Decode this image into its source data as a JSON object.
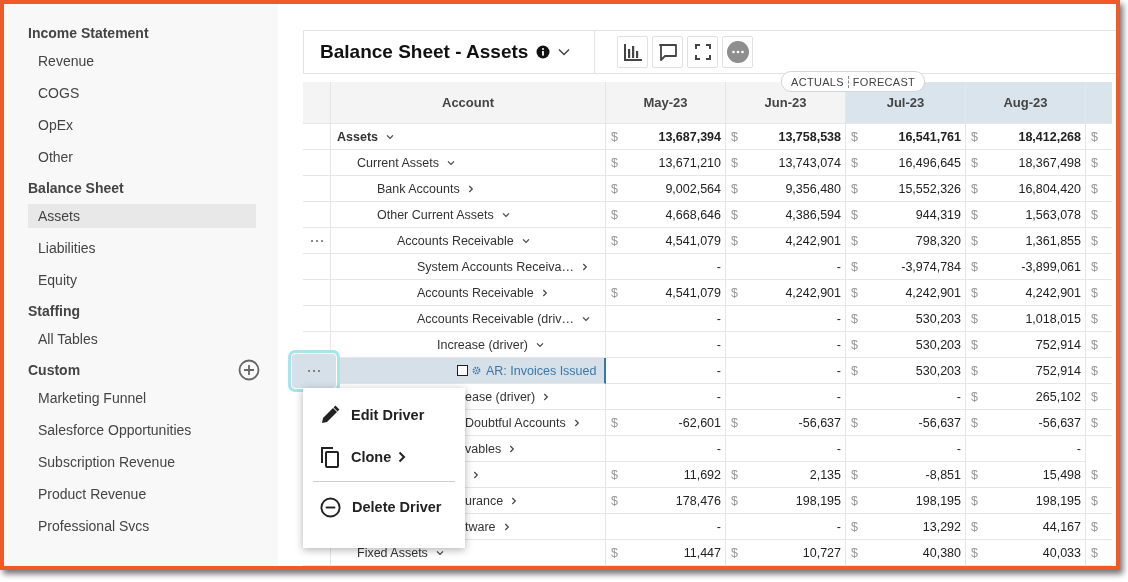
{
  "sidebar": {
    "sections": [
      {
        "title": "Income Statement",
        "items": [
          {
            "label": "Revenue",
            "selected": false
          },
          {
            "label": "COGS",
            "selected": false
          },
          {
            "label": "OpEx",
            "selected": false
          },
          {
            "label": "Other",
            "selected": false
          }
        ]
      },
      {
        "title": "Balance Sheet",
        "items": [
          {
            "label": "Assets",
            "selected": true
          },
          {
            "label": "Liabilities",
            "selected": false
          },
          {
            "label": "Equity",
            "selected": false
          }
        ]
      },
      {
        "title": "Staffing",
        "items": [
          {
            "label": "All Tables",
            "selected": false
          }
        ]
      },
      {
        "title": "Custom",
        "add_button": true,
        "items": [
          {
            "label": "Marketing Funnel",
            "selected": false
          },
          {
            "label": "Salesforce Opportunities",
            "selected": false
          },
          {
            "label": "Subscription Revenue",
            "selected": false
          },
          {
            "label": "Product Revenue",
            "selected": false
          },
          {
            "label": "Professional Svcs",
            "selected": false
          }
        ]
      }
    ]
  },
  "report": {
    "title": "Balance Sheet - Assets",
    "toolbar": [
      {
        "kind": "chart"
      },
      {
        "kind": "comment"
      },
      {
        "kind": "fullscreen"
      },
      {
        "kind": "more"
      }
    ]
  },
  "timeline": {
    "actuals": "ACTUALS",
    "forecast": "FORECAST"
  },
  "table": {
    "account_header": "Account",
    "columns": [
      {
        "label": "May-23",
        "forecast": false
      },
      {
        "label": "Jun-23",
        "forecast": false
      },
      {
        "label": "Jul-23",
        "forecast": true
      },
      {
        "label": "Aug-23",
        "forecast": true
      },
      {
        "forecast": true
      }
    ],
    "rows": [
      {
        "label": "Assets",
        "kind": "group",
        "expanded": true,
        "bold": true,
        "selected": false,
        "cells": [
          {
            "symbol": "$",
            "value": "13,687,394"
          },
          {
            "symbol": "$",
            "value": "13,758,538"
          },
          {
            "symbol": "$",
            "value": "16,541,761"
          },
          {
            "symbol": "$",
            "value": "18,412,268"
          },
          {
            "symbol": "$"
          }
        ],
        "children": [
          {
            "label": "Current Assets",
            "kind": "group",
            "expanded": true,
            "selected": false,
            "cells": [
              {
                "symbol": "$",
                "value": "13,671,210"
              },
              {
                "symbol": "$",
                "value": "13,743,074"
              },
              {
                "symbol": "$",
                "value": "16,496,645"
              },
              {
                "symbol": "$",
                "value": "18,367,498"
              },
              {
                "symbol": "$"
              }
            ],
            "children": [
              {
                "label": "Bank Accounts",
                "kind": "group",
                "expanded": false,
                "selected": false,
                "cells": [
                  {
                    "symbol": "$",
                    "value": "9,002,564"
                  },
                  {
                    "symbol": "$",
                    "value": "9,356,480"
                  },
                  {
                    "symbol": "$",
                    "value": "15,552,326"
                  },
                  {
                    "symbol": "$",
                    "value": "16,804,420"
                  },
                  {
                    "symbol": "$"
                  }
                ]
              },
              {
                "label": "Other Current Assets",
                "kind": "group",
                "expanded": true,
                "selected": false,
                "cells": [
                  {
                    "symbol": "$",
                    "value": "4,668,646"
                  },
                  {
                    "symbol": "$",
                    "value": "4,386,594"
                  },
                  {
                    "symbol": "$",
                    "value": "944,319"
                  },
                  {
                    "symbol": "$",
                    "value": "1,563,078"
                  },
                  {
                    "symbol": "$"
                  }
                ],
                "children": [
                  {
                    "label": "Accounts Receivable",
                    "kind": "group",
                    "expanded": true,
                    "handle": true,
                    "selected": false,
                    "cells": [
                      {
                        "symbol": "$",
                        "value": "4,541,079"
                      },
                      {
                        "symbol": "$",
                        "value": "4,242,901"
                      },
                      {
                        "symbol": "$",
                        "value": "798,320"
                      },
                      {
                        "symbol": "$",
                        "value": "1,361,855"
                      },
                      {
                        "symbol": "$"
                      }
                    ],
                    "children": [
                      {
                        "label": "System Accounts Receiva…",
                        "kind": "group",
                        "expanded": false,
                        "selected": false,
                        "cells": [
                          {
                            "value": "-"
                          },
                          {
                            "value": "-"
                          },
                          {
                            "symbol": "$",
                            "value": "-3,974,784"
                          },
                          {
                            "symbol": "$",
                            "value": "-3,899,061"
                          },
                          {
                            "symbol": "$"
                          }
                        ]
                      },
                      {
                        "label": "Accounts Receivable",
                        "kind": "group",
                        "expanded": false,
                        "selected": false,
                        "cells": [
                          {
                            "symbol": "$",
                            "value": "4,541,079"
                          },
                          {
                            "symbol": "$",
                            "value": "4,242,901"
                          },
                          {
                            "symbol": "$",
                            "value": "4,242,901"
                          },
                          {
                            "symbol": "$",
                            "value": "4,242,901"
                          },
                          {
                            "symbol": "$"
                          }
                        ]
                      },
                      {
                        "label": "Accounts Receivable (driv…",
                        "kind": "group",
                        "expanded": true,
                        "selected": false,
                        "cells": [
                          {
                            "value": "-"
                          },
                          {
                            "value": "-"
                          },
                          {
                            "symbol": "$",
                            "value": "530,203"
                          },
                          {
                            "symbol": "$",
                            "value": "1,018,015"
                          },
                          {
                            "symbol": "$"
                          }
                        ],
                        "children": [
                          {
                            "label": "Increase (driver)",
                            "kind": "group",
                            "expanded": true,
                            "selected": false,
                            "cells": [
                              {
                                "value": "-"
                              },
                              {
                                "value": "-"
                              },
                              {
                                "symbol": "$",
                                "value": "530,203"
                              },
                              {
                                "symbol": "$",
                                "value": "752,914"
                              },
                              {
                                "symbol": "$"
                              }
                            ],
                            "children": [
                              {
                                "label": "AR: Invoices Issued",
                                "kind": "driver",
                                "checked": false,
                                "selected": true,
                                "cells": [
                                  {
                                    "value": "-"
                                  },
                                  {
                                    "value": "-"
                                  },
                                  {
                                    "symbol": "$",
                                    "value": "530,203"
                                  },
                                  {
                                    "symbol": "$",
                                    "value": "752,914"
                                  },
                                  {
                                    "symbol": "$"
                                  }
                                ]
                              }
                            ]
                          },
                          {
                            "label": "ease (driver)",
                            "kind": "group",
                            "expanded": false,
                            "selected": false,
                            "cells": [
                              {
                                "value": "-"
                              },
                              {
                                "value": "-"
                              },
                              {
                                "value": "-"
                              },
                              {
                                "symbol": "$",
                                "value": "265,102"
                              },
                              {
                                "symbol": "$"
                              }
                            ]
                          }
                        ]
                      },
                      {
                        "label": "Doubtful Accounts",
                        "kind": "group",
                        "expanded": false,
                        "selected": false,
                        "cells": [
                          {
                            "symbol": "$",
                            "value": "-62,601"
                          },
                          {
                            "symbol": "$",
                            "value": "-56,637"
                          },
                          {
                            "symbol": "$",
                            "value": "-56,637"
                          },
                          {
                            "symbol": "$",
                            "value": "-56,637"
                          },
                          {
                            "symbol": "$"
                          }
                        ]
                      }
                    ]
                  },
                  {
                    "label": "vables",
                    "kind": "group",
                    "expanded": false,
                    "selected": false,
                    "cells": [
                      {
                        "value": "-"
                      },
                      {
                        "value": "-"
                      },
                      {
                        "value": "-"
                      },
                      {
                        "value": "-"
                      }
                    ]
                  },
                  {
                    "kind": "group",
                    "expanded": false,
                    "selected": false,
                    "cells": [
                      {
                        "symbol": "$",
                        "value": "11,692"
                      },
                      {
                        "symbol": "$",
                        "value": "2,135"
                      },
                      {
                        "symbol": "$",
                        "value": "-8,851"
                      },
                      {
                        "symbol": "$",
                        "value": "15,498"
                      },
                      {
                        "symbol": "$"
                      }
                    ]
                  },
                  {
                    "label": "urance",
                    "kind": "group",
                    "expanded": false,
                    "selected": false,
                    "cells": [
                      {
                        "symbol": "$",
                        "value": "178,476"
                      },
                      {
                        "symbol": "$",
                        "value": "198,195"
                      },
                      {
                        "symbol": "$",
                        "value": "198,195"
                      },
                      {
                        "symbol": "$",
                        "value": "198,195"
                      },
                      {
                        "symbol": "$"
                      }
                    ]
                  },
                  {
                    "label": "tware",
                    "kind": "group",
                    "expanded": false,
                    "selected": false,
                    "cells": [
                      {
                        "value": "-"
                      },
                      {
                        "value": "-"
                      },
                      {
                        "symbol": "$",
                        "value": "13,292"
                      },
                      {
                        "symbol": "$",
                        "value": "44,167"
                      },
                      {
                        "symbol": "$"
                      }
                    ]
                  }
                ]
              }
            ]
          },
          {
            "label": "Fixed Assets",
            "kind": "group",
            "expanded": true,
            "selected": false,
            "cells": [
              {
                "symbol": "$",
                "value": "11,447"
              },
              {
                "symbol": "$",
                "value": "10,727"
              },
              {
                "symbol": "$",
                "value": "40,380"
              },
              {
                "symbol": "$",
                "value": "40,033"
              },
              {
                "symbol": "$"
              }
            ]
          }
        ]
      }
    ]
  },
  "row_menu": {
    "items": [
      {
        "kind": "edit",
        "label": "Edit Driver"
      },
      {
        "kind": "clone",
        "label": "Clone",
        "submenu": true
      },
      {
        "kind": "delete",
        "label": "Delete Driver",
        "divider_before": true
      }
    ]
  }
}
